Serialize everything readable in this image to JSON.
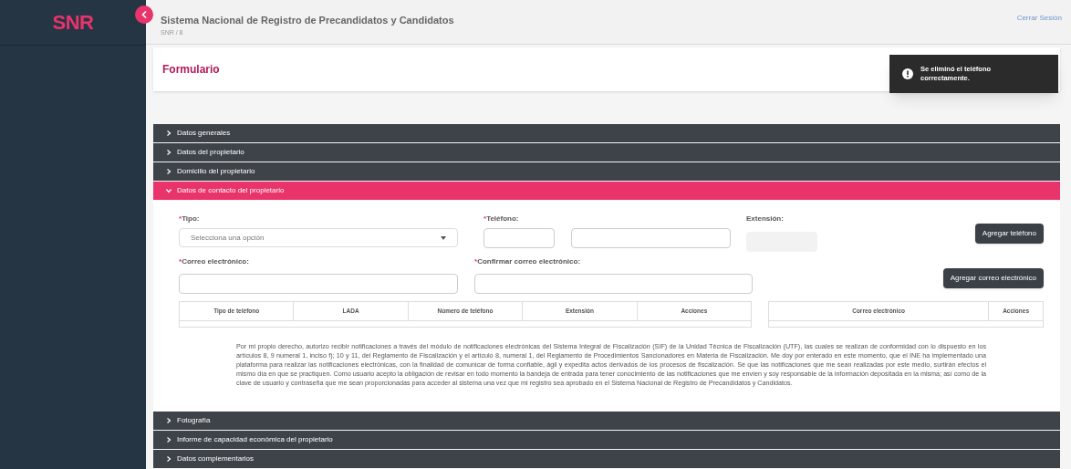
{
  "sidebar": {
    "logo": "SNR"
  },
  "header": {
    "title": "Sistema Nacional de Registro de Precandidatos y Candidatos",
    "breadcrumb": "SNR / 8",
    "logout": "Cerrar Sesión"
  },
  "page_title": "Formulario",
  "toast": {
    "message": "Se eliminó el teléfono correctamente."
  },
  "sections": [
    {
      "title": "Datos generales",
      "expanded": false
    },
    {
      "title": "Datos del propietario",
      "expanded": false
    },
    {
      "title": "Domicilio del propietario",
      "expanded": false
    },
    {
      "title": "Datos de contacto del propietario",
      "expanded": true
    },
    {
      "title": "Fotografía",
      "expanded": false
    },
    {
      "title": "Informe de capacidad económica del propietario",
      "expanded": false
    },
    {
      "title": "Datos complementarios",
      "expanded": false
    }
  ],
  "contact_form": {
    "required_mark": "*",
    "tipo": {
      "label": "Tipo:",
      "required": true,
      "placeholder": "Selecciona una opción"
    },
    "telefono": {
      "label": "Teléfono:",
      "required": true
    },
    "extension": {
      "label": "Extensión:",
      "required": false,
      "disabled": true
    },
    "add_phone": "Agregar teléfono",
    "correo": {
      "label": "Correo electrónico:",
      "required": true
    },
    "confirmar": {
      "label": "Confirmar correo electrónico:",
      "required": true
    },
    "add_email": "Agregar correo electrónico",
    "phone_table": {
      "columns": [
        "Tipo de teléfono",
        "LADA",
        "Número de teléfono",
        "Extensión",
        "Acciones"
      ]
    },
    "email_table": {
      "columns": [
        "Correo electrónico",
        "Acciones"
      ]
    },
    "notice": "Por mi propio derecho, autorizo recibir notificaciones a través del módulo de notificaciones electrónicas del Sistema Integral de Fiscalización (SIF) de la Unidad Técnica de Fiscalización (UTF), las cuales se realizan de conformidad con lo dispuesto en los artículos 8, 9 numeral 1, inciso f); 10 y 11, del Reglamento de Fiscalización y el artículo 8, numeral 1, del Reglamento de Procedimientos Sancionadores en Materia de Fiscalización. Me doy por enterado en este momento, que el INE ha implementado una plataforma para realizar las notificaciones electrónicas, con la finalidad de comunicar de forma confiable, ágil y expedita actos derivados de los procesos de fiscalización. Sé que las notificaciones que me sean realizadas por este medio, surtirán efectos el mismo día en que se practiquen. Como usuario acepto la obligación de revisar en todo momento la bandeja de entrada para tener conocimiento de las notificaciones que me envíen y soy responsable de la información depositada en la misma; así como de la clave de usuario y contraseña que me sean proporcionadas para acceder al sistema una vez que mi registro sea aprobado en el Sistema Nacional de Registro de Precandidatos y Candidatos."
  }
}
